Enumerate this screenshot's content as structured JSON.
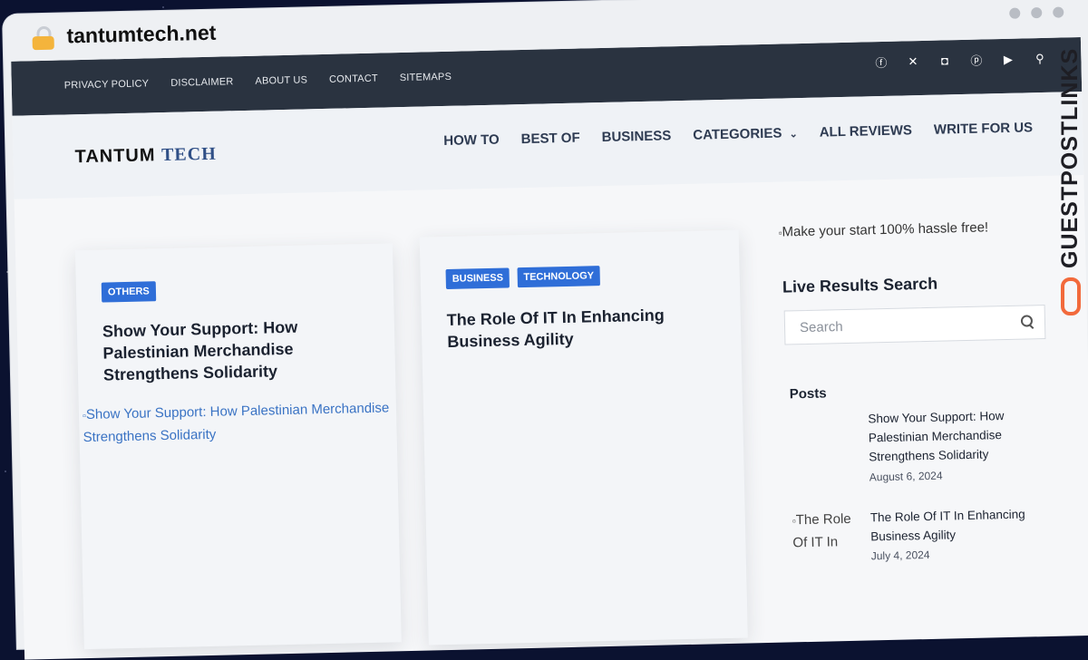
{
  "browser": {
    "url": "tantumtech.net"
  },
  "topbar": {
    "links": [
      "PRIVACY POLICY",
      "DISCLAIMER",
      "ABOUT US",
      "CONTACT",
      "SITEMAPS"
    ],
    "social_icons": [
      "facebook-icon",
      "x-icon",
      "instagram-icon",
      "pinterest-icon",
      "youtube-icon",
      "search-icon"
    ]
  },
  "header": {
    "logo_part1": "TANTUM",
    "logo_part2": "TECH",
    "nav": [
      "HOW TO",
      "BEST OF",
      "BUSINESS",
      "CATEGORIES",
      "ALL REVIEWS",
      "WRITE FOR US"
    ]
  },
  "cards": [
    {
      "tags": [
        "OTHERS"
      ],
      "title": "Show Your Support: How Palestinian Merchandise Strengthens Solidarity",
      "image_alt": "Show Your Support: How Palestinian Merchandise Strengthens Solidarity"
    },
    {
      "tags": [
        "BUSINESS",
        "TECHNOLOGY"
      ],
      "title": "The Role Of IT In Enhancing Business Agility"
    }
  ],
  "sidebar": {
    "ad_alt": "Make your start 100% hassle free!",
    "search_title": "Live Results Search",
    "search_placeholder": "Search",
    "posts_title": "Posts",
    "posts": [
      {
        "thumb_alt": "",
        "title": "Show Your Support: How Palestinian Merchandise Strengthens Solidarity",
        "date": "August 6, 2024"
      },
      {
        "thumb_alt": "The Role Of IT In",
        "title": "The Role Of IT In Enhancing Business Agility",
        "date": "July 4, 2024"
      }
    ]
  },
  "watermark": {
    "text": "GUESTPOSTLINKS",
    "accent": "#f26a3c"
  },
  "colors": {
    "topbar": "#2a3340",
    "tag": "#2f6ed8",
    "lock": "#f4b43c"
  }
}
